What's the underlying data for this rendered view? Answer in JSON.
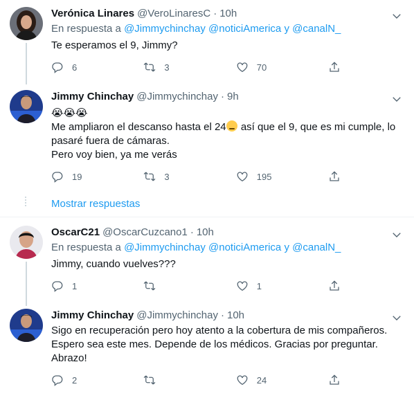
{
  "tweets": [
    {
      "name": "Verónica Linares",
      "handle": "@VeroLinaresC",
      "dot": "·",
      "time": "10h",
      "reply_prefix": "En respuesta a",
      "mention1": "@Jimmychinchay",
      "mention2": "@noticiAmerica",
      "reply_and": "y",
      "mention3": "@canalN_",
      "lines": [
        "Te esperamos el 9, Jimmy?"
      ],
      "replies": "6",
      "retweets": "3",
      "likes": "70"
    },
    {
      "name": "Jimmy Chinchay",
      "handle": "@Jimmychinchay",
      "dot": "·",
      "time": "9h",
      "emoji_line": "😭😭😭",
      "line1_a": "Me ampliaron el descanso hasta el 24",
      "line1_b": " así que el 9, que es mi cumple, lo",
      "line2": "pasaré fuera de cámaras.",
      "line3": "Pero voy bien, ya me verás",
      "replies": "19",
      "retweets": "3",
      "likes": "195"
    },
    {
      "name": "OscarC21",
      "handle": "@OscarCuzcano1",
      "dot": "·",
      "time": "10h",
      "reply_prefix": "En respuesta a",
      "mention1": "@Jimmychinchay",
      "mention2": "@noticiAmerica",
      "reply_and": "y",
      "mention3": "@canalN_",
      "lines": [
        "Jimmy, cuando vuelves???"
      ],
      "replies": "1",
      "retweets": "",
      "likes": "1"
    },
    {
      "name": "Jimmy Chinchay",
      "handle": "@Jimmychinchay",
      "dot": "·",
      "time": "10h",
      "lines": [
        "Sigo en recuperación pero hoy atento a la cobertura de mis compañeros.",
        "Espero sea este mes. Depende de los médicos. Gracias por preguntar.",
        "Abrazo!"
      ],
      "replies": "2",
      "retweets": "",
      "likes": "24"
    }
  ],
  "show_replies_label": "Mostrar respuestas",
  "icons": {
    "reply": "reply-icon",
    "retweet": "retweet-icon",
    "like": "heart-icon",
    "share": "share-icon",
    "more": "chevron-down-icon"
  },
  "colors": {
    "link": "#1d9bf0",
    "secondary_text": "#536471",
    "thread_line": "#cfd9de"
  }
}
